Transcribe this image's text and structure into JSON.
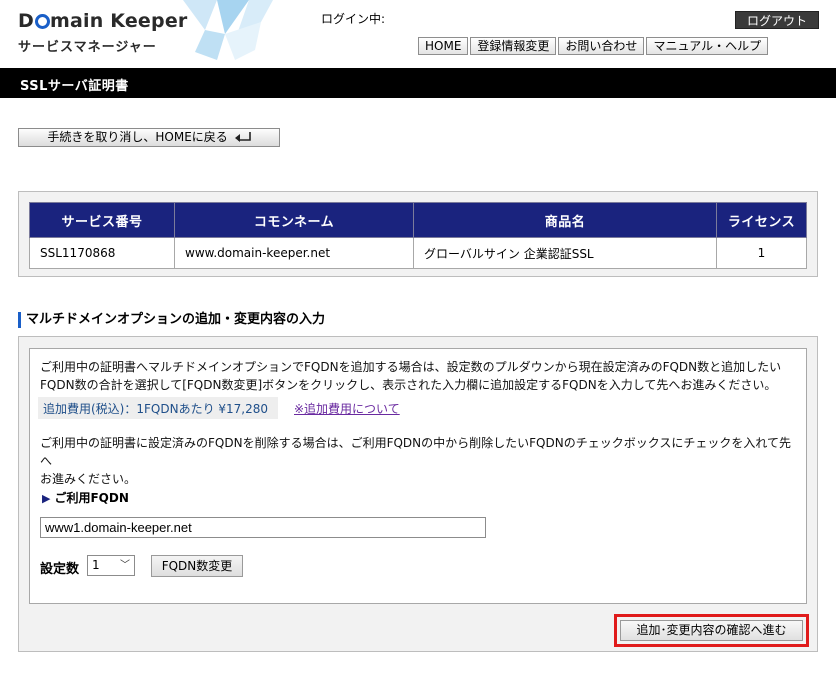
{
  "header": {
    "logo_title_left": "D",
    "logo_title_right": "main Keeper",
    "logo_subtitle": "サービスマネージャー",
    "login_status": "ログイン中:",
    "logout_label": "ログアウト",
    "nav": [
      "HOME",
      "登録情報変更",
      "お問い合わせ",
      "マニュアル・ヘルプ"
    ],
    "page_title": "SSLサーバ証明書"
  },
  "cancel_button": "手続きを取り消し、HOMEに戻る",
  "cancel_icon": "return-arrow-icon",
  "table": {
    "headers": [
      "サービス番号",
      "コモンネーム",
      "商品名",
      "ライセンス"
    ],
    "rows": [
      [
        "SSL1170868",
        "www.domain-keeper.net",
        "グローバルサイン 企業認証SSL",
        "1"
      ]
    ]
  },
  "section": {
    "heading": "マルチドメインオプションの追加・変更内容の入力",
    "para1_line1": "ご利用中の証明書へマルチドメインオプションでFQDNを追加する場合は、設定数のプルダウンから現在設定済みのFQDN数と追加したい",
    "para1_line2": "FQDN数の合計を選択して[FQDN数変更]ボタンをクリックし、表示された入力欄に追加設定するFQDNを入力して先へお進みください。",
    "fee_text": "追加費用(税込)：1FQDNあたり ¥17,280",
    "fee_link": "※追加費用について",
    "para2_line1": "ご利用中の証明書に設定済みのFQDNを削除する場合は、ご利用FQDNの中から削除したいFQDNのチェックボックスにチェックを入れて先へ",
    "para2_line2": "お進みください。",
    "fqdn_heading": "ご利用FQDN",
    "fqdn_value": "www1.domain-keeper.net",
    "count_label": "設定数",
    "count_value": "1",
    "fqdn_change_button": "FQDN数変更",
    "confirm_button": "追加･変更内容の確認へ進む"
  },
  "colors": {
    "table_header_bg": "#1a237e",
    "title_bar_bg": "#000000",
    "highlight_border": "#e01b1b",
    "heading_accent": "#1a5fc8",
    "fee_link": "#6a2aa0"
  }
}
